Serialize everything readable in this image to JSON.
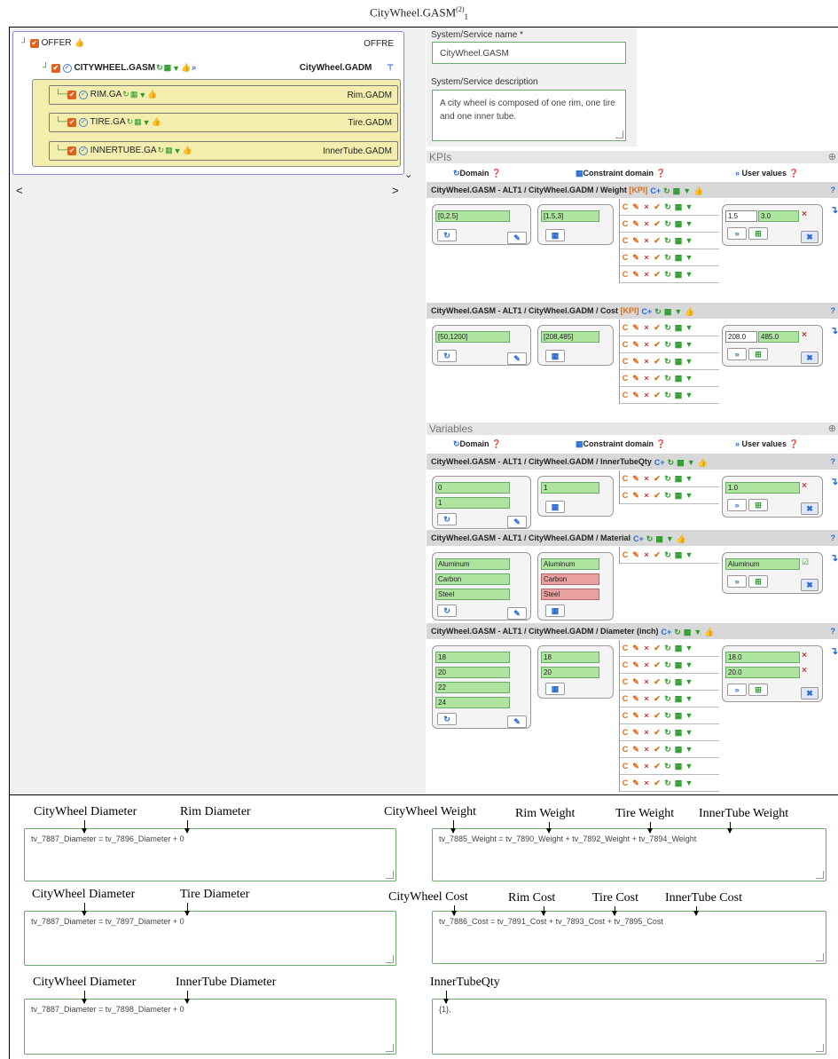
{
  "figure_title": "CityWheel.GASM",
  "figure_title_sup": "(2)",
  "figure_title_sub": "1",
  "tree": {
    "offer": {
      "label": "OFFER",
      "right": "OFFRE"
    },
    "root": {
      "label": "CITYWHEEL.GASM",
      "right": "CityWheel.GADM"
    },
    "children": [
      {
        "label": "RIM.GA",
        "right": "Rim.GADM"
      },
      {
        "label": "TIRE.GA",
        "right": "Tire.GADM"
      },
      {
        "label": "INNERTUBE.GA",
        "right": "InnerTube.GADM"
      }
    ]
  },
  "scroll": {
    "left": "<",
    "right": ">",
    "down": "⌄"
  },
  "form": {
    "name_label": "System/Service name",
    "name_req": "*",
    "name_value": "CityWheel.GASM",
    "desc_label": "System/Service description",
    "desc_value": "A city wheel is composed of one rim, one tire and one inner tube."
  },
  "kpis_title": "KPIs",
  "variables_title": "Variables",
  "col_headers": {
    "domain": "Domain",
    "constraint": "Constraint domain",
    "user": "User values"
  },
  "kpi_label": "[KPI]",
  "matrix_icons": {
    "c": "C",
    "edit": "✎",
    "x": "×",
    "check": "✔",
    "refresh": "↻",
    "calc": "▦",
    "filter": "▼"
  },
  "blocks": {
    "weight": {
      "title": "CityWheel.GASM - ALT1 / CityWheel.GADM / Weight",
      "domain": [
        "[0,2.5]"
      ],
      "constraint": [
        "[1.5,3]"
      ],
      "user": [
        [
          "1.5",
          "3.0"
        ]
      ]
    },
    "cost": {
      "title": "CityWheel.GASM - ALT1 / CityWheel.GADM / Cost",
      "domain": [
        "[50,1200]"
      ],
      "constraint": [
        "[208,485]"
      ],
      "user": [
        [
          "208.0",
          "485.0"
        ]
      ]
    },
    "innertubeqty": {
      "title": "CityWheel.GASM - ALT1 / CityWheel.GADM / InnerTubeQty",
      "domain": [
        "0",
        "1"
      ],
      "constraint": [
        "1"
      ],
      "user": [
        "1.0"
      ]
    },
    "material": {
      "title": "CityWheel.GASM - ALT1 / CityWheel.GADM / Material",
      "domain": [
        "Aluminum",
        "Carbon",
        "Steel"
      ],
      "constraint": [
        "Aluminum",
        "Carbon",
        "Steel"
      ],
      "user": [
        "Aluminum"
      ]
    },
    "diameter": {
      "title": "CityWheel.GASM - ALT1 / CityWheel.GADM / Diameter (inch)",
      "domain": [
        "18",
        "20",
        "22",
        "24"
      ],
      "constraint": [
        "18",
        "20"
      ],
      "user": [
        "18.0",
        "20.0"
      ]
    }
  },
  "equations": [
    {
      "text": "tv_7887_Diameter = tv_7896_Diameter + 0",
      "labels": [
        "CityWheel Diameter",
        "Rim Diameter"
      ]
    },
    {
      "text": "tv_7885_Weight = tv_7890_Weight + tv_7892_Weight + tv_7894_Weight",
      "labels": [
        "CityWheel Weight",
        "Rim Weight",
        "Tire Weight",
        "InnerTube Weight"
      ]
    },
    {
      "text": "tv_7887_Diameter = tv_7897_Diameter + 0",
      "labels": [
        "CityWheel Diameter",
        "Tire Diameter"
      ]
    },
    {
      "text": "tv_7886_Cost = tv_7891_Cost + tv_7893_Cost + tv_7895_Cost",
      "labels": [
        "CityWheel Cost",
        "Rim Cost",
        "Tire Cost",
        "InnerTube Cost"
      ]
    },
    {
      "text": "tv_7887_Diameter = tv_7898_Diameter + 0",
      "labels": [
        "CityWheel Diameter",
        "InnerTube Diameter"
      ]
    },
    {
      "text": "{1},",
      "labels": [
        "InnerTubeQty"
      ]
    }
  ]
}
